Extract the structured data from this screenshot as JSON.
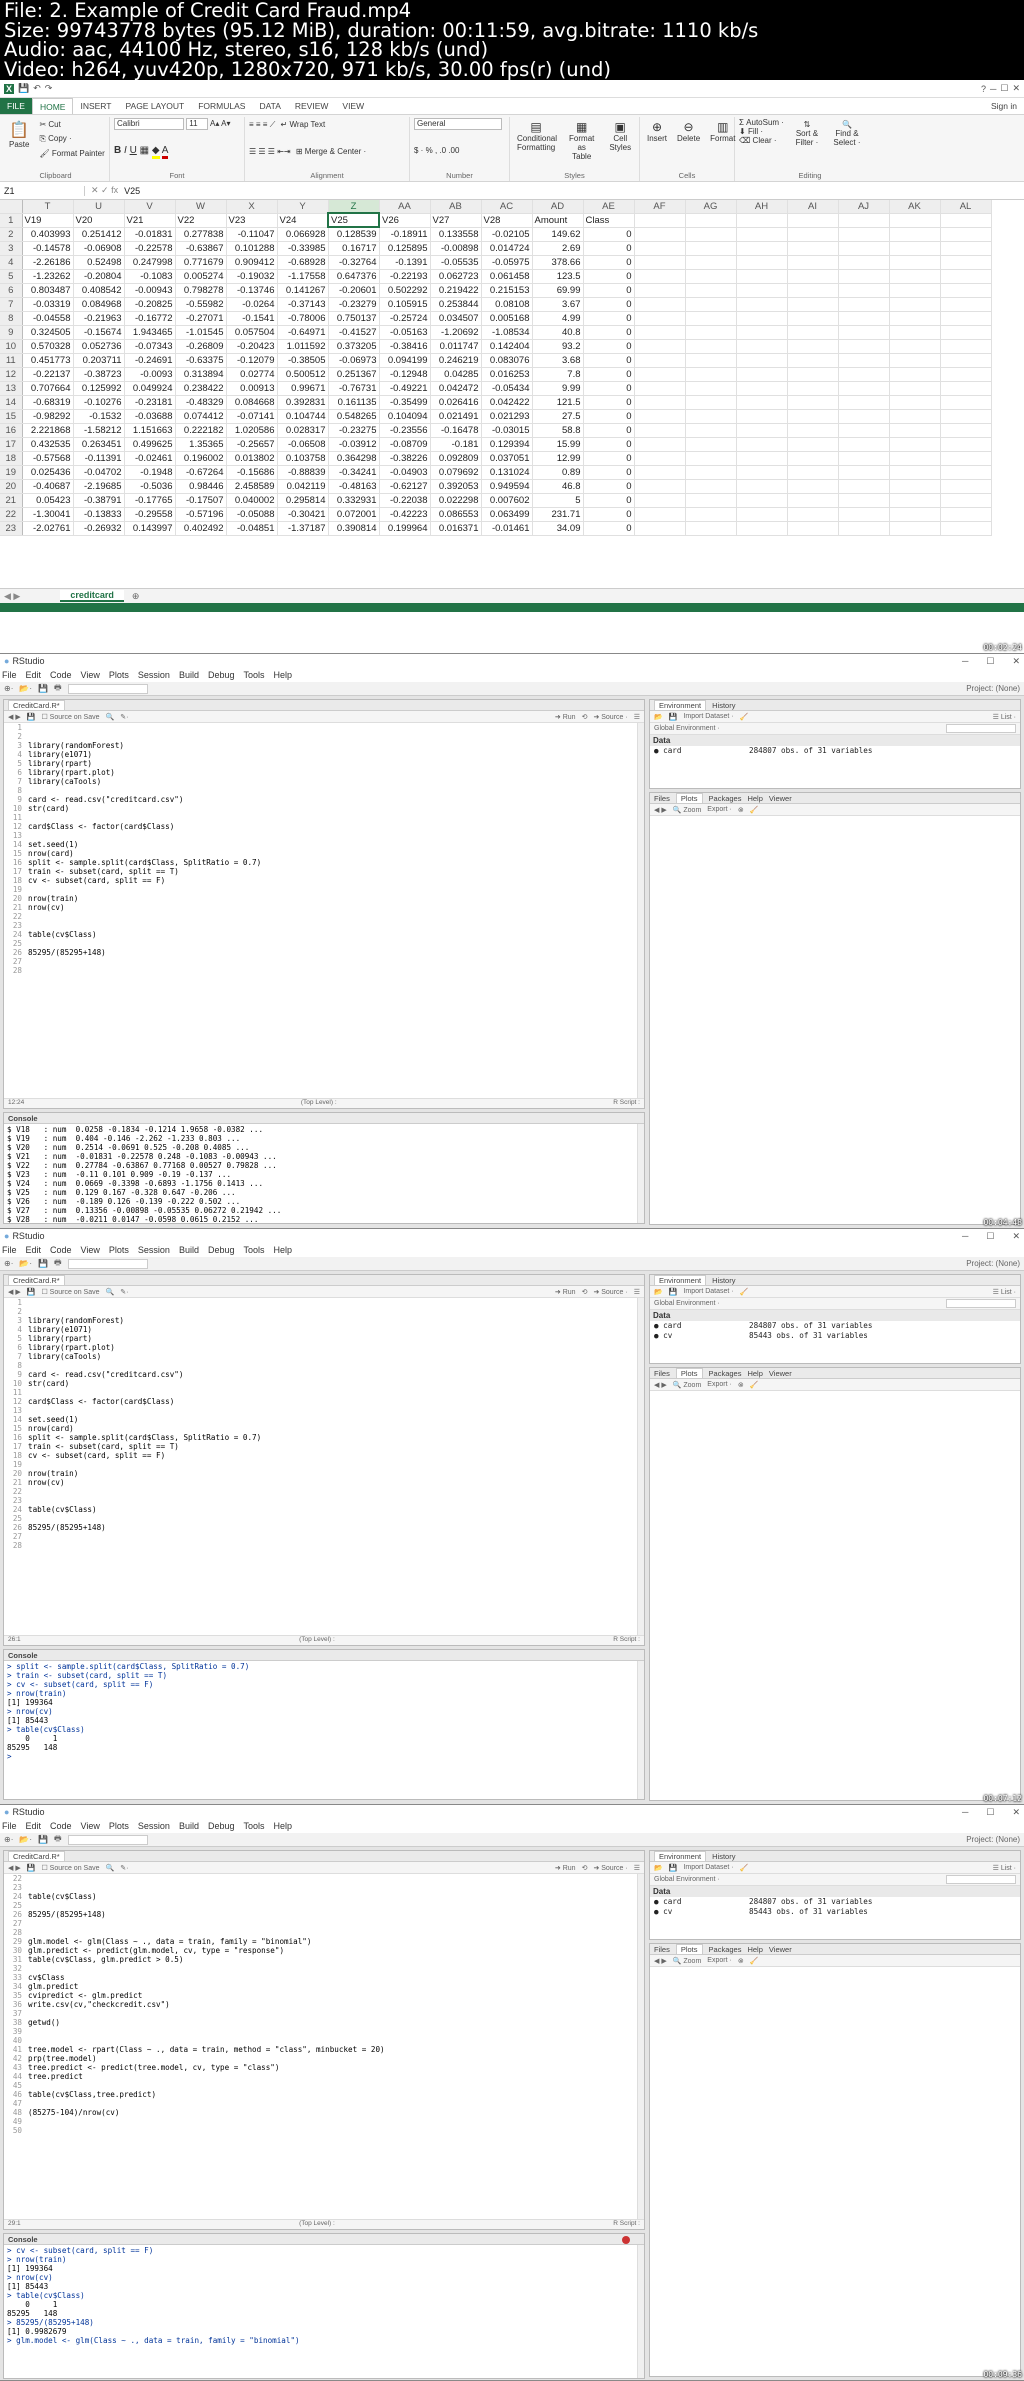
{
  "header": {
    "lines": [
      "File: 2. Example of Credit Card Fraud.mp4",
      "Size: 99743778 bytes (95.12 MiB), duration: 00:11:59, avg.bitrate: 1110 kb/s",
      "Audio: aac, 44100 Hz, stereo, s16, 128 kb/s (und)",
      "Video: h264, yuv420p, 1280x720, 971 kb/s, 30.00 fps(r) (und)"
    ]
  },
  "excel": {
    "help": "?",
    "signin": "Sign in",
    "tabs": [
      "FILE",
      "HOME",
      "INSERT",
      "PAGE LAYOUT",
      "FORMULAS",
      "DATA",
      "REVIEW",
      "VIEW"
    ],
    "clipboard": {
      "cut": "Cut",
      "copy": "Copy ·",
      "painter": "Format Painter",
      "paste": "Paste",
      "label": "Clipboard"
    },
    "font": {
      "name": "Calibri",
      "size": "11",
      "label": "Font"
    },
    "alignment": {
      "wrap": "Wrap Text",
      "merge": "Merge & Center ·",
      "label": "Alignment"
    },
    "number": {
      "format": "General",
      "label": "Number"
    },
    "styles": {
      "cond": "Conditional Formatting",
      "table": "Format as Table",
      "cell": "Cell Styles",
      "label": "Styles"
    },
    "cells": {
      "insert": "Insert",
      "delete": "Delete",
      "format": "Format",
      "label": "Cells"
    },
    "editing": {
      "autosum": "AutoSum ·",
      "fill": "Fill ·",
      "clear": "Clear ·",
      "sort": "Sort & Filter ·",
      "find": "Find & Select ·",
      "label": "Editing"
    },
    "namebox": "Z1",
    "formula": "V25",
    "col_headers": [
      "T",
      "U",
      "V",
      "W",
      "X",
      "Y",
      "Z",
      "AA",
      "AB",
      "AC",
      "AD",
      "AE",
      "AF",
      "AG",
      "AH",
      "AI",
      "AJ",
      "AK",
      "AL"
    ],
    "rows": [
      [
        "1",
        "V19",
        "V20",
        "V21",
        "V22",
        "V23",
        "V24",
        "V25",
        "V26",
        "V27",
        "V28",
        "Amount",
        "Class"
      ],
      [
        "2",
        "0.403993",
        "0.251412",
        "-0.01831",
        "0.277838",
        "-0.11047",
        "0.066928",
        "0.128539",
        "-0.18911",
        "0.133558",
        "-0.02105",
        "149.62",
        "0"
      ],
      [
        "3",
        "-0.14578",
        "-0.06908",
        "-0.22578",
        "-0.63867",
        "0.101288",
        "-0.33985",
        "0.16717",
        "0.125895",
        "-0.00898",
        "0.014724",
        "2.69",
        "0"
      ],
      [
        "4",
        "-2.26186",
        "0.52498",
        "0.247998",
        "0.771679",
        "0.909412",
        "-0.68928",
        "-0.32764",
        "-0.1391",
        "-0.05535",
        "-0.05975",
        "378.66",
        "0"
      ],
      [
        "5",
        "-1.23262",
        "-0.20804",
        "-0.1083",
        "0.005274",
        "-0.19032",
        "-1.17558",
        "0.647376",
        "-0.22193",
        "0.062723",
        "0.061458",
        "123.5",
        "0"
      ],
      [
        "6",
        "0.803487",
        "0.408542",
        "-0.00943",
        "0.798278",
        "-0.13746",
        "0.141267",
        "-0.20601",
        "0.502292",
        "0.219422",
        "0.215153",
        "69.99",
        "0"
      ],
      [
        "7",
        "-0.03319",
        "0.084968",
        "-0.20825",
        "-0.55982",
        "-0.0264",
        "-0.37143",
        "-0.23279",
        "0.105915",
        "0.253844",
        "0.08108",
        "3.67",
        "0"
      ],
      [
        "8",
        "-0.04558",
        "-0.21963",
        "-0.16772",
        "-0.27071",
        "-0.1541",
        "-0.78006",
        "0.750137",
        "-0.25724",
        "0.034507",
        "0.005168",
        "4.99",
        "0"
      ],
      [
        "9",
        "0.324505",
        "-0.15674",
        "1.943465",
        "-1.01545",
        "0.057504",
        "-0.64971",
        "-0.41527",
        "-0.05163",
        "-1.20692",
        "-1.08534",
        "40.8",
        "0"
      ],
      [
        "10",
        "0.570328",
        "0.052736",
        "-0.07343",
        "-0.26809",
        "-0.20423",
        "1.011592",
        "0.373205",
        "-0.38416",
        "0.011747",
        "0.142404",
        "93.2",
        "0"
      ],
      [
        "11",
        "0.451773",
        "0.203711",
        "-0.24691",
        "-0.63375",
        "-0.12079",
        "-0.38505",
        "-0.06973",
        "0.094199",
        "0.246219",
        "0.083076",
        "3.68",
        "0"
      ],
      [
        "12",
        "-0.22137",
        "-0.38723",
        "-0.0093",
        "0.313894",
        "0.02774",
        "0.500512",
        "0.251367",
        "-0.12948",
        "0.04285",
        "0.016253",
        "7.8",
        "0"
      ],
      [
        "13",
        "0.707664",
        "0.125992",
        "0.049924",
        "0.238422",
        "0.00913",
        "0.99671",
        "-0.76731",
        "-0.49221",
        "0.042472",
        "-0.05434",
        "9.99",
        "0"
      ],
      [
        "14",
        "-0.68319",
        "-0.10276",
        "-0.23181",
        "-0.48329",
        "0.084668",
        "0.392831",
        "0.161135",
        "-0.35499",
        "0.026416",
        "0.042422",
        "121.5",
        "0"
      ],
      [
        "15",
        "-0.98292",
        "-0.1532",
        "-0.03688",
        "0.074412",
        "-0.07141",
        "0.104744",
        "0.548265",
        "0.104094",
        "0.021491",
        "0.021293",
        "27.5",
        "0"
      ],
      [
        "16",
        "2.221868",
        "-1.58212",
        "1.151663",
        "0.222182",
        "1.020586",
        "0.028317",
        "-0.23275",
        "-0.23556",
        "-0.16478",
        "-0.03015",
        "58.8",
        "0"
      ],
      [
        "17",
        "0.432535",
        "0.263451",
        "0.499625",
        "1.35365",
        "-0.25657",
        "-0.06508",
        "-0.03912",
        "-0.08709",
        "-0.181",
        "0.129394",
        "15.99",
        "0"
      ],
      [
        "18",
        "-0.57568",
        "-0.11391",
        "-0.02461",
        "0.196002",
        "0.013802",
        "0.103758",
        "0.364298",
        "-0.38226",
        "0.092809",
        "0.037051",
        "12.99",
        "0"
      ],
      [
        "19",
        "0.025436",
        "-0.04702",
        "-0.1948",
        "-0.67264",
        "-0.15686",
        "-0.88839",
        "-0.34241",
        "-0.04903",
        "0.079692",
        "0.131024",
        "0.89",
        "0"
      ],
      [
        "20",
        "-0.40687",
        "-2.19685",
        "-0.5036",
        "0.98446",
        "2.458589",
        "0.042119",
        "-0.48163",
        "-0.62127",
        "0.392053",
        "0.949594",
        "46.8",
        "0"
      ],
      [
        "21",
        "0.05423",
        "-0.38791",
        "-0.17765",
        "-0.17507",
        "0.040002",
        "0.295814",
        "0.332931",
        "-0.22038",
        "0.022298",
        "0.007602",
        "5",
        "0"
      ],
      [
        "22",
        "-1.30041",
        "-0.13833",
        "-0.29558",
        "-0.57196",
        "-0.05088",
        "-0.30421",
        "0.072001",
        "-0.42223",
        "0.086553",
        "0.063499",
        "231.71",
        "0"
      ],
      [
        "23",
        "-2.02761",
        "-0.26932",
        "0.143997",
        "0.402492",
        "-0.04851",
        "-1.37187",
        "0.390814",
        "0.199964",
        "0.016371",
        "-0.01461",
        "34.09",
        "0"
      ]
    ],
    "sheet": "creditcard"
  },
  "rs1": {
    "title": "RStudio",
    "menu": [
      "File",
      "Edit",
      "Code",
      "View",
      "Plots",
      "Session",
      "Build",
      "Debug",
      "Tools",
      "Help"
    ],
    "project": "Project: (None)",
    "file_tab": "CreditCard.R*",
    "run": "Run",
    "source": "Source",
    "source_on_save": "Source on Save",
    "code": [
      "",
      "",
      "library(randomForest)",
      "library(e1071)",
      "library(rpart)",
      "library(rpart.plot)",
      "library(caTools)",
      "",
      "card <- read.csv(\"creditcard.csv\")",
      "str(card)",
      "",
      "card$Class <- factor(card$Class)",
      "",
      "set.seed(1)",
      "nrow(card)",
      "split <- sample.split(card$Class, SplitRatio = 0.7)",
      "train <- subset(card, split == T)",
      "cv <- subset(card, split == F)",
      "",
      "nrow(train)",
      "nrow(cv)",
      "",
      "",
      "table(cv$Class)",
      "",
      "85295/(85295+148)",
      "",
      ""
    ],
    "status_l": "12:24",
    "status_m": "(Top Level) :",
    "status_r": "R Script :",
    "console_label": "Console",
    "console": [
      "$ V18   : num  0.0258 -0.1834 -0.1214 1.9658 -0.0382 ...",
      "$ V19   : num  0.404 -0.146 -2.262 -1.233 0.803 ...",
      "$ V20   : num  0.2514 -0.0691 0.525 -0.208 0.4085 ...",
      "$ V21   : num  -0.01831 -0.22578 0.248 -0.1083 -0.00943 ...",
      "$ V22   : num  0.27784 -0.63867 0.77168 0.00527 0.79828 ...",
      "$ V23   : num  -0.11 0.101 0.909 -0.19 -0.137 ...",
      "$ V24   : num  0.0669 -0.3398 -0.6893 -1.1756 0.1413 ...",
      "$ V25   : num  0.129 0.167 -0.328 0.647 -0.206 ...",
      "$ V26   : num  -0.189 0.126 -0.139 -0.222 0.502 ...",
      "$ V27   : num  0.13356 -0.00898 -0.05535 0.06272 0.21942 ...",
      "$ V28   : num  -0.0211 0.0147 -0.0598 0.0615 0.2152 ...",
      "$ Amount: num  149.62 2.69 378.66 123.5 69.99 ...",
      "$ Class : int  0 0 0 0 0 0 0 0 0 0 ..."
    ],
    "env_tabs": [
      "Environment",
      "History"
    ],
    "import": "Import Dataset ·",
    "global": "Global Environment ·",
    "data_label": "Data",
    "env": [
      [
        "card",
        "284807 obs. of 31 variables"
      ]
    ],
    "files_tabs": [
      "Files",
      "Plots",
      "Packages",
      "Help",
      "Viewer"
    ],
    "zoom": "Zoom",
    "export": "Export ·"
  },
  "rs2": {
    "file_tab": "CreditCard.R*",
    "code": [
      "",
      "",
      "library(randomForest)",
      "library(e1071)",
      "library(rpart)",
      "library(rpart.plot)",
      "library(caTools)",
      "",
      "card <- read.csv(\"creditcard.csv\")",
      "str(card)",
      "",
      "card$Class <- factor(card$Class)",
      "",
      "set.seed(1)",
      "nrow(card)",
      "split <- sample.split(card$Class, SplitRatio = 0.7)",
      "train <- subset(card, split == T)",
      "cv <- subset(card, split == F)",
      "",
      "nrow(train)",
      "nrow(cv)",
      "",
      "",
      "table(cv$Class)",
      "",
      "85295/(85295+148)",
      "",
      ""
    ],
    "status_l": "26:1",
    "console": [
      "> split <- sample.split(card$Class, SplitRatio = 0.7)",
      "> train <- subset(card, split == T)",
      "> cv <- subset(card, split == F)",
      "> nrow(train)",
      "[1] 199364",
      "> nrow(cv)",
      "[1] 85443",
      "> table(cv$Class)",
      "",
      "    0     1",
      "85295   148",
      ">"
    ],
    "env": [
      [
        "card",
        "284807 obs. of 31 variables"
      ],
      [
        "cv",
        "85443 obs. of 31 variables"
      ]
    ]
  },
  "rs3": {
    "file_tab": "CreditCard.R*",
    "code": [
      "",
      "",
      "table(cv$Class)",
      "",
      "85295/(85295+148)",
      "",
      "",
      "glm.model <- glm(Class ~ ., data = train, family = \"binomial\")",
      "glm.predict <- predict(glm.model, cv, type = \"response\")",
      "table(cv$Class, glm.predict > 0.5)",
      "",
      "cv$Class",
      "glm.predict",
      "cvipredict <- glm.predict",
      "write.csv(cv,\"checkcredit.csv\")",
      "",
      "getwd()",
      "",
      "",
      "tree.model <- rpart(Class ~ ., data = train, method = \"class\", minbucket = 20)",
      "prp(tree.model)",
      "tree.predict <- predict(tree.model, cv, type = \"class\")",
      "tree.predict",
      "",
      "table(cv$Class,tree.predict)",
      "",
      "(85275-104)/nrow(cv)",
      "",
      ""
    ],
    "first_line": 22,
    "status_l": "29:1",
    "console": [
      "> cv <- subset(card, split == F)",
      "> nrow(train)",
      "[1] 199364",
      "> nrow(cv)",
      "[1] 85443",
      "> table(cv$Class)",
      "",
      "    0     1",
      "85295   148",
      "> 85295/(85295+148)",
      "[1] 0.9982679",
      "> glm.model <- glm(Class ~ ., data = train, family = \"binomial\")"
    ],
    "env": [
      [
        "card",
        "284807 obs. of 31 variables"
      ],
      [
        "cv",
        "85443 obs. of 31 variables"
      ]
    ]
  },
  "timestamps": [
    "00:02:24",
    "00:04:48",
    "00:07:12",
    "00:09:36"
  ]
}
